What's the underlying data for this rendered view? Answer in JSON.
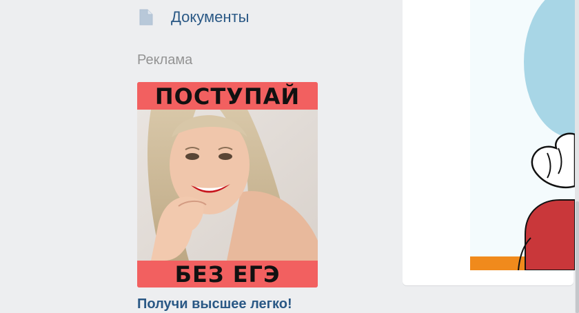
{
  "sidebar": {
    "documents_item": {
      "label": "Документы",
      "icon": "document-icon"
    },
    "ads_title": "Реклама",
    "ad": {
      "headline_top": "ПОСТУПАЙ",
      "headline_bottom": "БЕЗ ЕГЭ",
      "image": "smiling-woman-photo",
      "link_text": "Получи высшее легко!"
    }
  },
  "colors": {
    "link": "#2a5885",
    "muted": "#939393",
    "page_bg": "#edeef0",
    "ad_red": "#f26060",
    "card_bg": "#ffffff"
  }
}
